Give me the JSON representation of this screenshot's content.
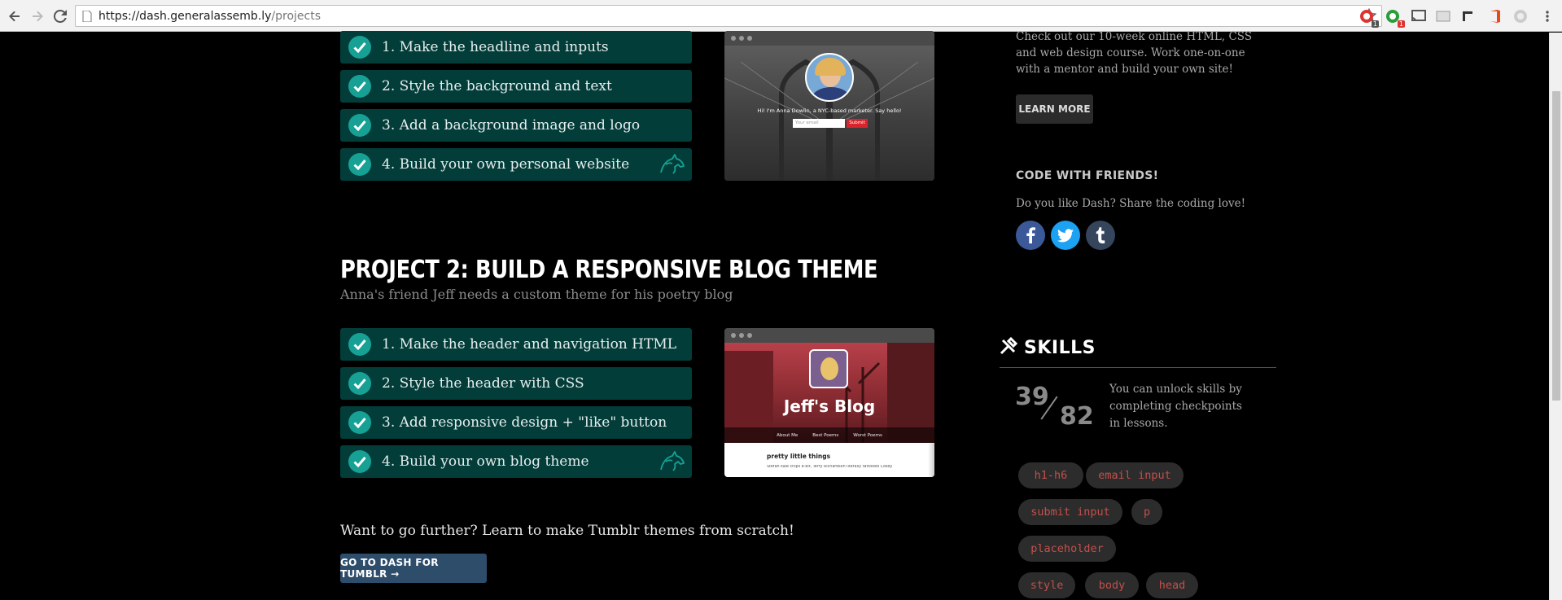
{
  "browser": {
    "url_host": "https://dash.generalassemb.ly",
    "url_path": "/projects",
    "ext_badge_1": "1",
    "ext_badge_2": "1"
  },
  "project1": {
    "steps": [
      {
        "label": "1. Make the headline and inputs",
        "done": true
      },
      {
        "label": "2. Style the background and text",
        "done": true
      },
      {
        "label": "3. Add a background image and logo",
        "done": true
      },
      {
        "label": "4. Build your own personal website",
        "done": true
      }
    ],
    "preview": {
      "tagline": "Hi! I'm Anna Dowlin, a NYC-based marketer. Say hello!",
      "email_placeholder": "Your email",
      "submit": "Submit"
    }
  },
  "project2": {
    "title": "PROJECT 2: BUILD A RESPONSIVE BLOG THEME",
    "subtitle": "Anna's friend Jeff needs a custom theme for his poetry blog",
    "steps": [
      {
        "label": "1. Make the header and navigation HTML",
        "done": true
      },
      {
        "label": "2. Style the header with CSS",
        "done": true
      },
      {
        "label": "3. Add responsive design + \"like\" button",
        "done": true
      },
      {
        "label": "4. Build your own blog theme",
        "done": true
      }
    ],
    "preview": {
      "blog_title": "Jeff's Blog",
      "nav": [
        "About Me",
        "Best Poems",
        "Worst Poems"
      ],
      "post_title": "pretty little things",
      "post_text": "Stefan kale chips 8-bit, Terry Richardson literally tattooed Cosby"
    }
  },
  "further": {
    "text": "Want to go further? Learn to make Tumblr themes from scratch!",
    "button": "GO TO DASH FOR TUMBLR →"
  },
  "sidebar": {
    "course_text": "Check out our 10-week online HTML, CSS and web design course. Work one-on-one with a mentor and build your own site!",
    "learn_more": "LEARN MORE",
    "code_friends_heading": "CODE WITH FRIENDS!",
    "code_friends_text": "Do you like Dash? Share the coding love!",
    "social": [
      "facebook",
      "twitter",
      "tumblr"
    ]
  },
  "skills": {
    "heading": "SKILLS",
    "unlocked": "39",
    "total": "82",
    "unlock_text": "You can unlock skills by completing checkpoints in lessons.",
    "tags": [
      "h1-h6",
      "email input",
      "submit input",
      "p",
      "placeholder",
      "style",
      "body",
      "head"
    ]
  },
  "colors": {
    "row_bg": "#033d3a",
    "tick": "#16a194",
    "tag_text": "#c3504a",
    "tumblr_button": "#2e4d6b"
  }
}
